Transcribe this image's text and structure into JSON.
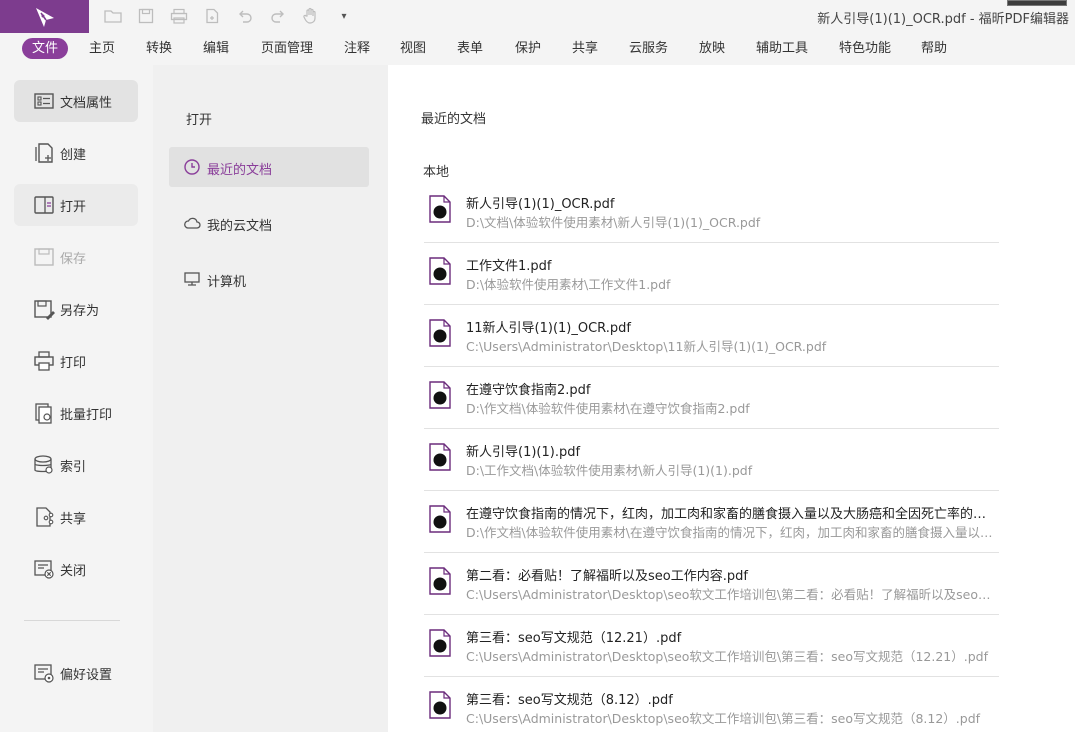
{
  "app": {
    "window_title": "新人引导(1)(1)_OCR.pdf - 福昕PDF编辑器",
    "brand_color": "#7d3c8e",
    "accent_color": "#8a3e9a"
  },
  "quick_access": [
    {
      "icon": "folder-open-icon"
    },
    {
      "icon": "save-icon"
    },
    {
      "icon": "print-icon"
    },
    {
      "icon": "new-file-icon"
    },
    {
      "icon": "undo-icon"
    },
    {
      "icon": "redo-icon"
    },
    {
      "icon": "hand-tool-icon"
    },
    {
      "icon": "customize-dropdown-icon",
      "label": "▾"
    }
  ],
  "menu": {
    "file": "文件",
    "home": "主页",
    "convert": "转换",
    "edit": "编辑",
    "page_manage": "页面管理",
    "comment": "注释",
    "view": "视图",
    "form": "表单",
    "protect": "保护",
    "share": "共享",
    "cloud": "云服务",
    "slideshow": "放映",
    "tools": "辅助工具",
    "features": "特色功能",
    "help": "帮助"
  },
  "leftnav": {
    "properties": "文档属性",
    "create": "创建",
    "open": "打开",
    "save": "保存",
    "save_as": "另存为",
    "print": "打印",
    "batch_print": "批量打印",
    "index": "索引",
    "share": "共享",
    "close": "关闭",
    "preferences": "偏好设置"
  },
  "midpanel": {
    "title": "打开",
    "recent": "最近的文档",
    "cloud_docs": "我的云文档",
    "computer": "计算机"
  },
  "content": {
    "title": "最近的文档",
    "local_label": "本地",
    "files": [
      {
        "name": "新人引导(1)(1)_OCR.pdf",
        "path": "D:\\文档\\体验软件使用素材\\新人引导(1)(1)_OCR.pdf"
      },
      {
        "name": "工作文件1.pdf",
        "path": "D:\\体验软件使用素材\\工作文件1.pdf"
      },
      {
        "name": "11新人引导(1)(1)_OCR.pdf",
        "path": "C:\\Users\\Administrator\\Desktop\\11新人引导(1)(1)_OCR.pdf"
      },
      {
        "name": "在遵守饮食指南2.pdf",
        "path": "D:\\作文档\\体验软件使用素材\\在遵守饮食指南2.pdf"
      },
      {
        "name": "新人引导(1)(1).pdf",
        "path": "D:\\工作文档\\体验软件使用素材\\新人引导(1)(1).pdf"
      },
      {
        "name": "在遵守饮食指南的情况下，红肉，加工肉和家畜的膳食摄入量以及大肠癌和全因死亡率的风险†.pdf",
        "path": "D:\\作文档\\体验软件使用素材\\在遵守饮食指南的情况下，红肉，加工肉和家畜的膳食摄入量以及大肠癌和全因死亡率的风险†.pdf"
      },
      {
        "name": "第二看：必看贴！了解福昕以及seo工作内容.pdf",
        "path": "C:\\Users\\Administrator\\Desktop\\seo软文工作培训包\\第二看：必看贴！了解福昕以及seo工作内容.pdf"
      },
      {
        "name": "第三看：seo写文规范（12.21）.pdf",
        "path": "C:\\Users\\Administrator\\Desktop\\seo软文工作培训包\\第三看：seo写文规范（12.21）.pdf"
      },
      {
        "name": "第三看：seo写文规范（8.12）.pdf",
        "path": "C:\\Users\\Administrator\\Desktop\\seo软文工作培训包\\第三看：seo写文规范（8.12）.pdf"
      }
    ]
  }
}
